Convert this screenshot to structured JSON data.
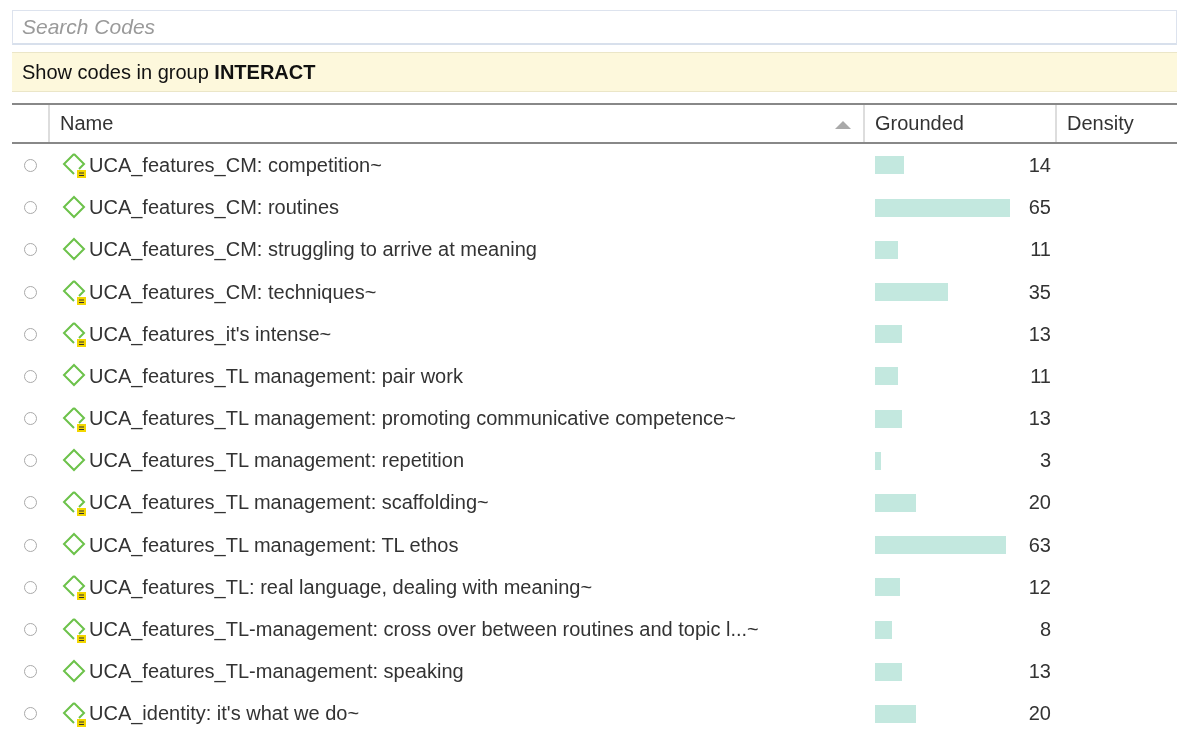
{
  "search": {
    "placeholder": "Search Codes"
  },
  "filter_bar": {
    "text": "Show codes in group **INTERACT**"
  },
  "table": {
    "columns": [
      {
        "label": "Name",
        "sorted": true
      },
      {
        "label": "Grounded",
        "sorted": false
      },
      {
        "label": "Density",
        "sorted": false
      }
    ],
    "rows": [
      {
        "selected": false,
        "commented": true,
        "name": "UCA_features_CM: competition~",
        "grounded": "14"
      },
      {
        "selected": false,
        "commented": false,
        "name": "UCA_features_CM: routines",
        "grounded": "65"
      },
      {
        "selected": false,
        "commented": false,
        "name": "UCA_features_CM: struggling to arrive at meaning",
        "grounded": "11"
      },
      {
        "selected": false,
        "commented": true,
        "name": "UCA_features_CM: techniques~",
        "grounded": "35"
      },
      {
        "selected": false,
        "commented": true,
        "name": "UCA_features_it's intense~",
        "grounded": "13"
      },
      {
        "selected": false,
        "commented": false,
        "name": "UCA_features_TL management: pair work",
        "grounded": "11"
      },
      {
        "selected": false,
        "commented": true,
        "name": "UCA_features_TL management: promoting communicative competence~",
        "grounded": "13"
      },
      {
        "selected": false,
        "commented": false,
        "name": "UCA_features_TL management: repetition",
        "grounded": "3"
      },
      {
        "selected": false,
        "commented": true,
        "name": "UCA_features_TL management: scaffolding~",
        "grounded": "20"
      },
      {
        "selected": false,
        "commented": false,
        "name": "UCA_features_TL management: TL ethos",
        "grounded": "63"
      },
      {
        "selected": false,
        "commented": true,
        "name": "UCA_features_TL: real language, dealing with meaning~",
        "grounded": "12"
      },
      {
        "selected": false,
        "commented": true,
        "name": "UCA_features_TL-management: cross over between routines and topic l...~",
        "grounded": "8"
      },
      {
        "selected": false,
        "commented": false,
        "name": "UCA_features_TL-management: speaking",
        "grounded": "13"
      },
      {
        "selected": false,
        "commented": true,
        "name": "UCA_identity: it's what we do~",
        "grounded": "20"
      }
    ]
  }
}
